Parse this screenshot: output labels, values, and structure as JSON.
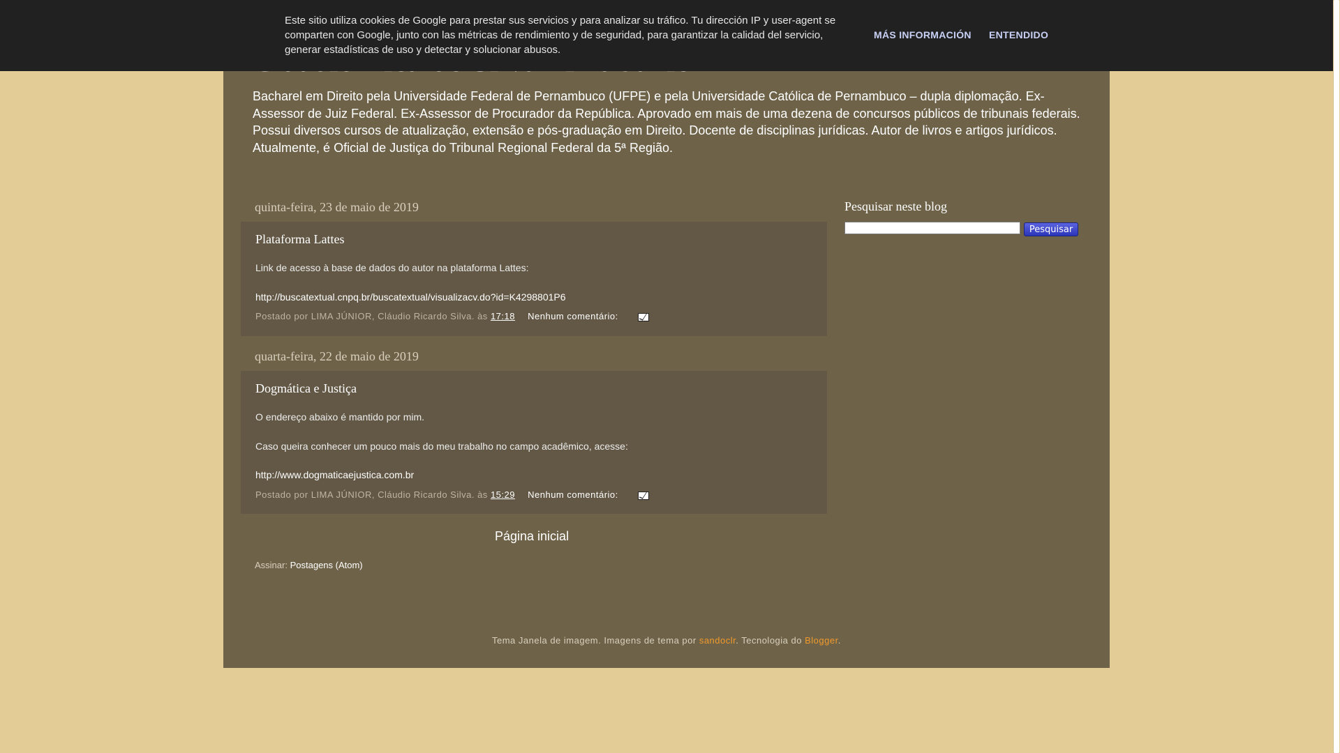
{
  "cookie_banner": {
    "text": "Este sitio utiliza cookies de Google para prestar sus servicios y para analizar su tráfico. Tu dirección IP y user-agent se comparten con Google, junto con las métricas de rendimiento y de seguridad, para garantizar la calidad del servicio, generar estadísticas de uso y detectar y solucionar abusos.",
    "more_info_label": "MÁS INFORMACIÓN",
    "ok_label": "ENTENDIDO"
  },
  "header": {
    "title": "Cláudio Ricardo Silva Lima Júnior",
    "description": "Bacharel em Direito pela Universidade Federal de Pernambuco (UFPE) e pela Universidade Católica de Pernambuco – dupla diplomação. Ex-Assessor de Juiz Federal. Ex-Assessor de Procurador da República. Aprovado em mais de uma dezena de concursos públicos de tribunais federais. Possui diversos cursos de atualização, extensão e pós-graduação em Direito. Docente de disciplinas jurídicas. Autor de livros e artigos jurídicos. Atualmente, é Oficial de Justiça do Tribunal Regional Federal da 5ª Região."
  },
  "posts": [
    {
      "date": "quinta-feira, 23 de maio de 2019",
      "title": "Plataforma Lattes",
      "paragraph1": "Link de acesso à base de dados do autor na plataforma Lattes:",
      "link": "http://buscatextual.cnpq.br/buscatextual/visualizacv.do?id=K4298801P6",
      "posted_by": "Postado por LIMA JÚNIOR, Cláudio Ricardo Silva. às",
      "time": "17:18",
      "comments": "Nenhum comentário:"
    },
    {
      "date": "quarta-feira, 22 de maio de 2019",
      "title": "Dogmática e Justiça",
      "paragraph1": "O endereço abaixo é mantido por mim.",
      "paragraph2": "Caso queira conhecer um pouco mais do meu trabalho no campo acadêmico, acesse:",
      "link": "http://www.dogmaticaejustica.com.br",
      "posted_by": "Postado por LIMA JÚNIOR, Cláudio Ricardo Silva. às",
      "time": "15:29",
      "comments": "Nenhum comentário:"
    }
  ],
  "home_link": "Página inicial",
  "subscribe": {
    "label": "Assinar:",
    "link": "Postagens (Atom)"
  },
  "sidebar": {
    "search_title": "Pesquisar neste blog",
    "search_value": "",
    "search_button": "Pesquisar"
  },
  "attribution": {
    "prefix": "Tema Janela de imagem. Imagens de tema por",
    "author": "sandoclr",
    "middle": ". Tecnologia do",
    "platform": "Blogger",
    "suffix": "."
  },
  "colors": {
    "page_background": "#e3cc96",
    "content_background": "#6e6249",
    "post_background": "#625845",
    "cookie_bar": "#212121",
    "link_orange": "#f19a2b"
  },
  "icons": [
    "email-icon"
  ]
}
